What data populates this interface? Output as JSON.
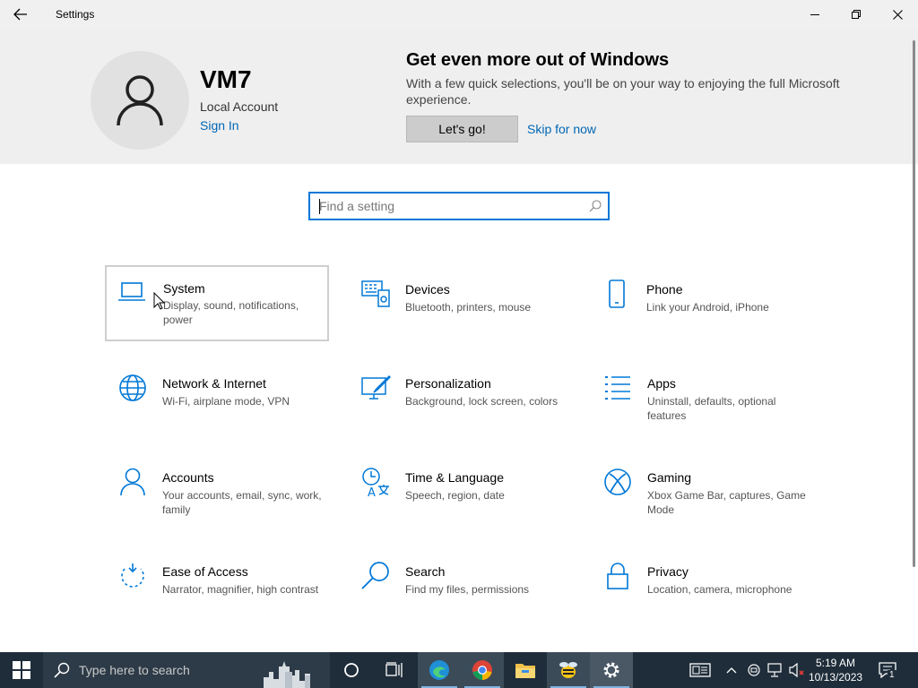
{
  "window": {
    "title": "Settings"
  },
  "header": {
    "user_name": "VM7",
    "account_type": "Local Account",
    "sign_in": "Sign In",
    "promo_title": "Get even more out of Windows",
    "promo_text": "With a few quick selections, you'll be on your way to enjoying the full Microsoft experience.",
    "lets_go": "Let's go!",
    "skip": "Skip for now"
  },
  "search": {
    "placeholder": "Find a setting"
  },
  "categories": [
    {
      "title": "System",
      "desc": "Display, sound, notifications, power",
      "icon": "laptop-icon"
    },
    {
      "title": "Devices",
      "desc": "Bluetooth, printers, mouse",
      "icon": "devices-icon"
    },
    {
      "title": "Phone",
      "desc": "Link your Android, iPhone",
      "icon": "phone-icon"
    },
    {
      "title": "Network & Internet",
      "desc": "Wi-Fi, airplane mode, VPN",
      "icon": "globe-icon"
    },
    {
      "title": "Personalization",
      "desc": "Background, lock screen, colors",
      "icon": "paintbrush-icon"
    },
    {
      "title": "Apps",
      "desc": "Uninstall, defaults, optional features",
      "icon": "apps-list-icon"
    },
    {
      "title": "Accounts",
      "desc": "Your accounts, email, sync, work, family",
      "icon": "person-icon"
    },
    {
      "title": "Time & Language",
      "desc": "Speech, region, date",
      "icon": "time-language-icon"
    },
    {
      "title": "Gaming",
      "desc": "Xbox Game Bar, captures, Game Mode",
      "icon": "xbox-icon"
    },
    {
      "title": "Ease of Access",
      "desc": "Narrator, magnifier, high contrast",
      "icon": "ease-of-access-icon"
    },
    {
      "title": "Search",
      "desc": "Find my files, permissions",
      "icon": "search-icon"
    },
    {
      "title": "Privacy",
      "desc": "Location, camera, microphone",
      "icon": "lock-icon"
    }
  ],
  "taskbar": {
    "search_placeholder": "Type here to search",
    "time": "5:19 AM",
    "date": "10/13/2023",
    "notification_count": "1"
  },
  "colors": {
    "accent": "#0078d7",
    "link": "#0066b4",
    "taskbar": "#1f2d3a"
  }
}
